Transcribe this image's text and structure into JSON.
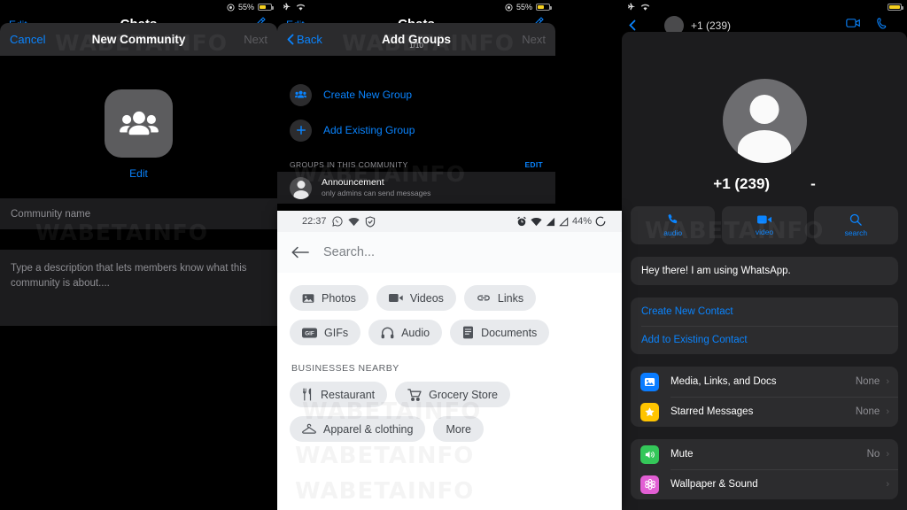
{
  "panel_new_community": {
    "status_bar": {
      "battery_percent": "55%",
      "location_icon": "location-icon",
      "airplane_icon": "airplane-icon",
      "wifi_icon": "wifi-icon"
    },
    "background_screen": {
      "edit": "Edit",
      "title": "Chats",
      "compose_icon": "compose-icon"
    },
    "navbar": {
      "cancel": "Cancel",
      "title": "New Community",
      "next": "Next"
    },
    "avatar_icon": "community-group-icon",
    "edit_photo_link": "Edit",
    "name_field_placeholder": "Community name",
    "description_placeholder": "Type a description that lets members know what this community is about...."
  },
  "panel_add_groups": {
    "status_bar": {
      "battery_percent": "55%",
      "airplane_icon": "airplane-icon",
      "wifi_icon": "wifi-icon",
      "location_icon": "location-icon"
    },
    "background_screen": {
      "edit": "Edit",
      "title": "Chats",
      "compose_icon": "compose-icon"
    },
    "navbar": {
      "back": "Back",
      "title": "Add Groups",
      "subtitle": "1/10",
      "next": "Next"
    },
    "actions": [
      {
        "label": "Create New Group",
        "icon": "group-people-icon"
      },
      {
        "label": "Add Existing Group",
        "icon": "plus-icon"
      }
    ],
    "section": {
      "header": "GROUPS IN THIS COMMUNITY",
      "edit": "EDIT"
    },
    "groups": [
      {
        "name": "Announcement",
        "subtitle": "only admins can send messages",
        "avatar_icon": "person-avatar-icon"
      }
    ]
  },
  "panel_search": {
    "status_bar": {
      "time": "22:37",
      "battery_percent": "44%",
      "icons_left": [
        "whatsapp-icon",
        "wifi-icon",
        "shield-check-icon"
      ],
      "icons_right": [
        "alarm-icon",
        "wifi-icon",
        "signal-icon",
        "signal-icon",
        "battery-circle-icon"
      ]
    },
    "back_icon": "arrow-left-icon",
    "search_placeholder": "Search...",
    "filter_chips": [
      {
        "label": "Photos",
        "icon": "photo-icon"
      },
      {
        "label": "Videos",
        "icon": "video-icon"
      },
      {
        "label": "Links",
        "icon": "link-icon"
      },
      {
        "label": "GIFs",
        "icon": "gif-icon"
      },
      {
        "label": "Audio",
        "icon": "headphones-icon"
      },
      {
        "label": "Documents",
        "icon": "document-icon"
      }
    ],
    "businesses_header": "BUSINESSES NEARBY",
    "business_chips": [
      {
        "label": "Restaurant",
        "icon": "cutlery-icon"
      },
      {
        "label": "Grocery Store",
        "icon": "shopping-cart-icon"
      },
      {
        "label": "Apparel & clothing",
        "icon": "hanger-icon"
      },
      {
        "label": "More",
        "icon": ""
      }
    ]
  },
  "panel_contact_info": {
    "status_bar": {
      "airplane_icon": "airplane-icon",
      "wifi_icon": "wifi-icon",
      "battery_icon": "battery-charging-icon"
    },
    "background_screen": {
      "name": "+1 (239)",
      "video_icon": "video-call-icon",
      "call_icon": "phone-call-icon",
      "back_icon": "chevron-left-icon"
    },
    "avatar_icon": "person-avatar-icon",
    "name": "+1 (239)",
    "name_suffix": "-",
    "quick_actions": [
      {
        "label": "audio",
        "icon": "phone-icon"
      },
      {
        "label": "video",
        "icon": "video-icon"
      },
      {
        "label": "search",
        "icon": "search-icon"
      }
    ],
    "about_status": "Hey there! I am using WhatsApp.",
    "contact_links": [
      {
        "label": "Create New Contact"
      },
      {
        "label": "Add to Existing Contact"
      }
    ],
    "media_rows": [
      {
        "label": "Media, Links, and Docs",
        "value": "None",
        "icon": "photo-icon",
        "color": "#0a7cff"
      },
      {
        "label": "Starred Messages",
        "value": "None",
        "icon": "star-icon",
        "color": "#ffc400"
      }
    ],
    "settings_rows": [
      {
        "label": "Mute",
        "value": "No",
        "icon": "speaker-icon",
        "color": "#34c759"
      },
      {
        "label": "Wallpaper & Sound",
        "value": "",
        "icon": "flower-icon",
        "color": "#e25fd4"
      }
    ]
  },
  "watermark": {
    "text": "WABETAINFO"
  },
  "colors": {
    "ios_blue": "#0a84ff",
    "dark_bg": "#000000",
    "card_bg": "#2c2c2e",
    "sheet_bg": "#1c1c1e"
  }
}
